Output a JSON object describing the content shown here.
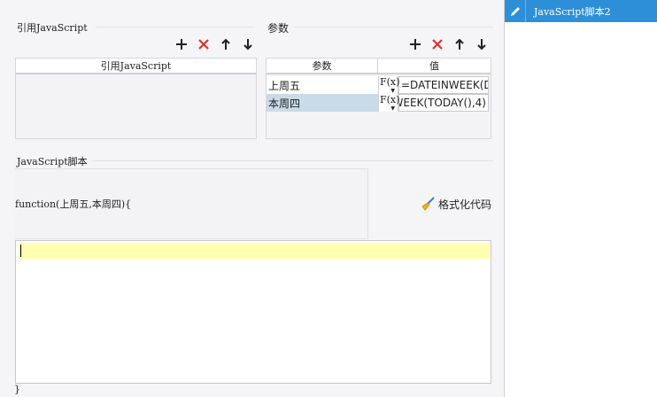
{
  "ref_section": {
    "title": "引用JavaScript",
    "column_header": "引用JavaScript",
    "items": []
  },
  "params_section": {
    "title": "参数",
    "columns": {
      "name": "参数",
      "value": "值"
    },
    "rows": [
      {
        "name": "上周五",
        "fx": "F(x)",
        "value": "=DATEINWEEK(D",
        "selected": false
      },
      {
        "name": "本周四",
        "fx": "F(x)",
        "value": "WEEK(TODAY(),4)",
        "selected": true
      }
    ]
  },
  "script_section": {
    "title": "JavaScript脚本",
    "function_signature": "function(上周五,本周四){",
    "closing_brace": "}",
    "format_button_label": "格式化代码",
    "editor_content": ""
  },
  "right_panel": {
    "items": [
      {
        "label": "JavaScript脚本2",
        "selected": true
      }
    ]
  },
  "toolbar_icons": [
    "plus-icon",
    "delete-icon",
    "arrow-up-icon",
    "arrow-down-icon"
  ],
  "colors": {
    "accent": "#2e8fd9",
    "delete": "#e03030",
    "selected_row": "#c9dbe8",
    "editor_line_highlight": "#ffffb0"
  }
}
